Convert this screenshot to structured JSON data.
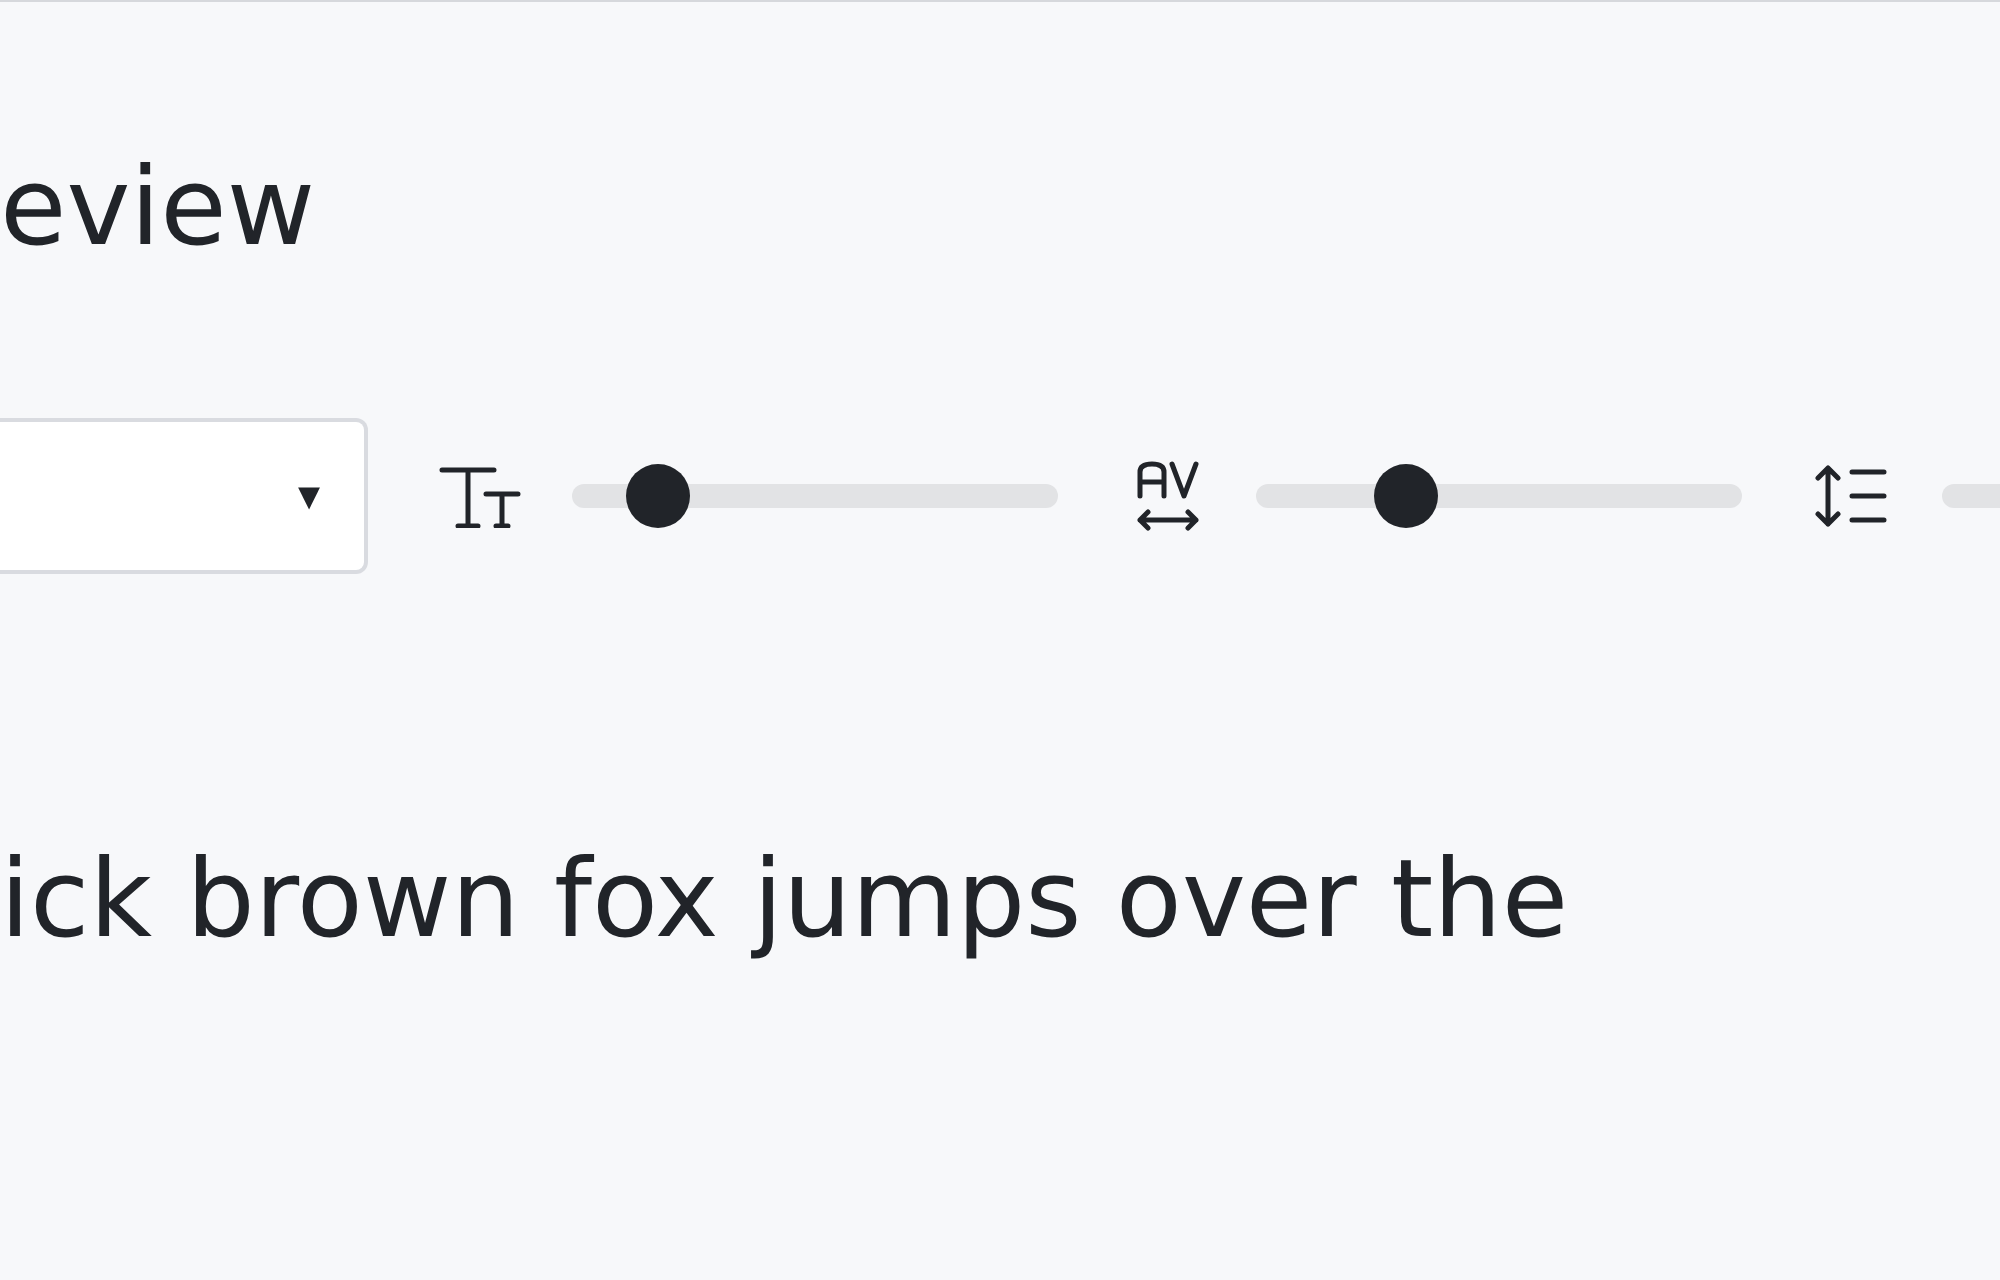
{
  "title": "eview",
  "controls": {
    "font_select": {
      "caret": "▾"
    },
    "sliders": [
      {
        "kind": "size",
        "level": 0.13
      },
      {
        "kind": "spacing",
        "level": 0.28
      },
      {
        "kind": "line-height"
      }
    ]
  },
  "preview_text": "ick brown fox jumps over the"
}
